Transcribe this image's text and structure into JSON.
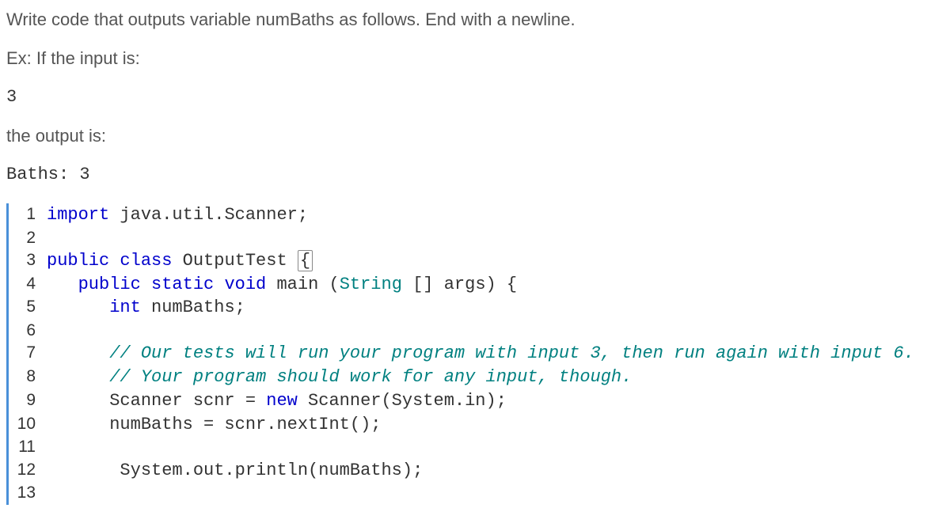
{
  "instructions": {
    "line1": "Write code that outputs variable numBaths as follows. End with a newline.",
    "line2": "Ex: If the input is:",
    "input_example": "3",
    "line3": "the output is:",
    "output_example": "Baths: 3"
  },
  "code": {
    "lines": [
      {
        "num": "1",
        "tokens": [
          {
            "cls": "kw-blue",
            "txt": "import"
          },
          {
            "cls": "",
            "txt": " java.util.Scanner;"
          }
        ]
      },
      {
        "num": "2",
        "tokens": []
      },
      {
        "num": "3",
        "tokens": [
          {
            "cls": "kw-blue",
            "txt": "public"
          },
          {
            "cls": "",
            "txt": " "
          },
          {
            "cls": "kw-blue",
            "txt": "class"
          },
          {
            "cls": "",
            "txt": " OutputTest "
          },
          {
            "cls": "cursor-box",
            "txt": "{"
          }
        ]
      },
      {
        "num": "4",
        "tokens": [
          {
            "cls": "",
            "txt": "   "
          },
          {
            "cls": "kw-blue",
            "txt": "public"
          },
          {
            "cls": "",
            "txt": " "
          },
          {
            "cls": "kw-blue",
            "txt": "static"
          },
          {
            "cls": "",
            "txt": " "
          },
          {
            "cls": "kw-blue",
            "txt": "void"
          },
          {
            "cls": "",
            "txt": " main ("
          },
          {
            "cls": "kw-teal",
            "txt": "String"
          },
          {
            "cls": "",
            "txt": " [] args) {"
          }
        ]
      },
      {
        "num": "5",
        "tokens": [
          {
            "cls": "",
            "txt": "      "
          },
          {
            "cls": "kw-blue",
            "txt": "int"
          },
          {
            "cls": "",
            "txt": " numBaths;"
          }
        ]
      },
      {
        "num": "6",
        "tokens": []
      },
      {
        "num": "7",
        "tokens": [
          {
            "cls": "",
            "txt": "      "
          },
          {
            "cls": "kw-comment",
            "txt": "// Our tests will run your program with input 3, then run again with input 6."
          }
        ]
      },
      {
        "num": "8",
        "tokens": [
          {
            "cls": "",
            "txt": "      "
          },
          {
            "cls": "kw-comment",
            "txt": "// Your program should work for any input, though."
          }
        ]
      },
      {
        "num": "9",
        "tokens": [
          {
            "cls": "",
            "txt": "      Scanner scnr = "
          },
          {
            "cls": "kw-blue",
            "txt": "new"
          },
          {
            "cls": "",
            "txt": " Scanner(System.in);"
          }
        ]
      },
      {
        "num": "10",
        "tokens": [
          {
            "cls": "",
            "txt": "      numBaths = scnr.nextInt();"
          }
        ]
      },
      {
        "num": "11",
        "tokens": []
      },
      {
        "num": "12",
        "tokens": [
          {
            "cls": "",
            "txt": "       System.out.println(numBaths);"
          }
        ]
      },
      {
        "num": "13",
        "tokens": []
      }
    ]
  }
}
